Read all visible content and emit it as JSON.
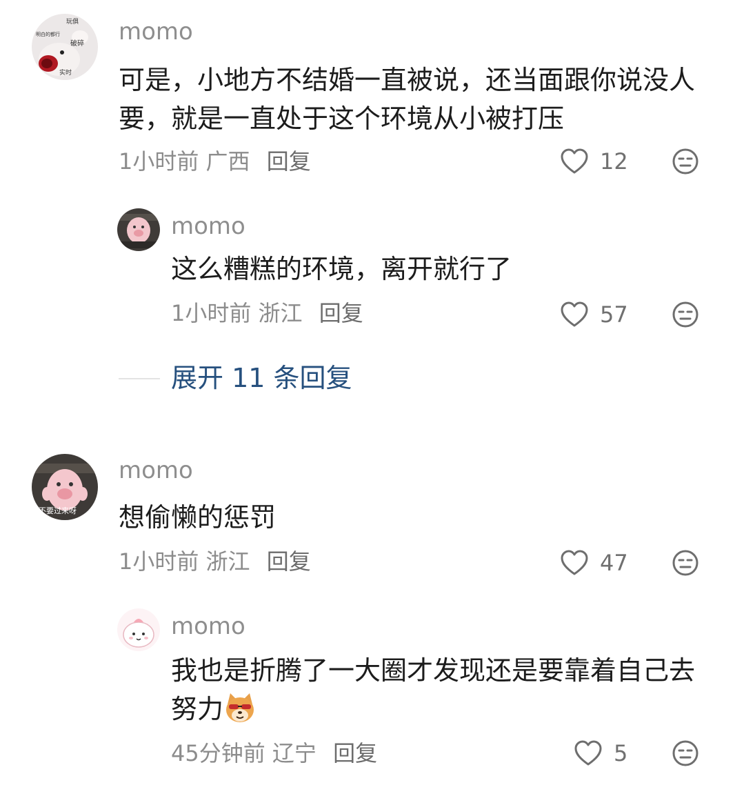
{
  "comments": [
    {
      "user": "momo",
      "text": "可是，小地方不结婚一直被说，还当面跟你说没人要，就是一直处于这个环境从小被打压",
      "time": "1小时前",
      "location": "广西",
      "reply_label": "回复",
      "likes": "12",
      "avatar_text": {
        "a": "玩俱",
        "b": "明白的都行",
        "c": "破碎",
        "d": "实时"
      },
      "replies": [
        {
          "user": "momo",
          "text": "这么糟糕的环境，离开就行了",
          "time": "1小时前",
          "location": "浙江",
          "reply_label": "回复",
          "likes": "57"
        }
      ],
      "expand_label": "展开 11 条回复"
    },
    {
      "user": "momo",
      "text": "想偷懒的惩罚",
      "time": "1小时前",
      "location": "浙江",
      "reply_label": "回复",
      "likes": "47",
      "avatar_text": "不要过来呀",
      "replies": [
        {
          "user": "momo",
          "text": "我也是折腾了一大圈才发现还是要靠着自己去努力",
          "time": "45分钟前",
          "location": "辽宁",
          "reply_label": "回复",
          "likes": "5"
        }
      ]
    }
  ],
  "icons": {
    "like": "heart-outline-icon",
    "dislike": "neutral-face-icon",
    "emoji": "shiba-dog-cool-emoji"
  },
  "colors": {
    "username": "#8e8e8e",
    "text": "#1c1c1c",
    "meta": "#8c8c8c",
    "expand": "#26507e"
  }
}
